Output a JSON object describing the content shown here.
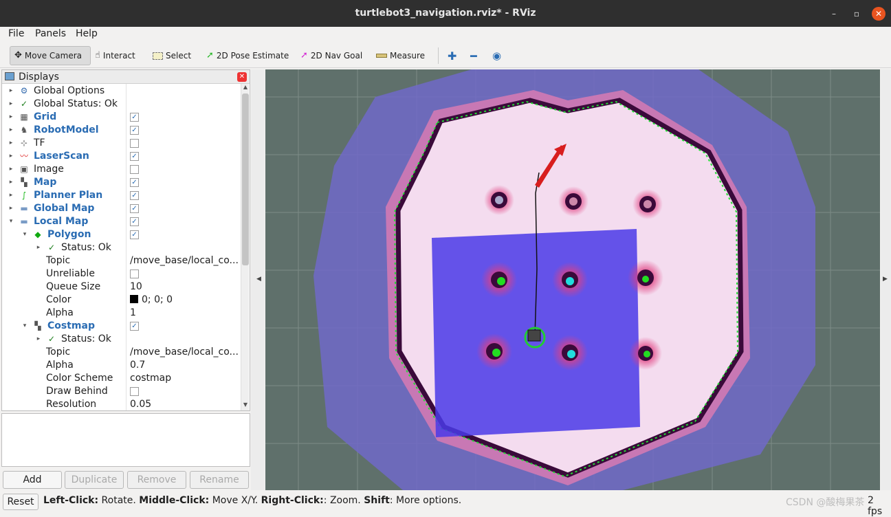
{
  "window": {
    "title": "turtlebot3_navigation.rviz* - RViz",
    "controls": [
      "–",
      "▫",
      "✕"
    ]
  },
  "menu": [
    "File",
    "Panels",
    "Help"
  ],
  "toolbar": {
    "tools": [
      "Move Camera",
      "Interact",
      "Select",
      "2D Pose Estimate",
      "2D Nav Goal",
      "Measure"
    ],
    "active": "Move Camera"
  },
  "displays": {
    "header": "Displays",
    "rows": [
      {
        "label": "Global Options",
        "icon": "gear-icon"
      },
      {
        "label": "Global Status: Ok",
        "icon": "check-icon"
      },
      {
        "label": "Grid",
        "icon": "grid-icon",
        "checked": true
      },
      {
        "label": "RobotModel",
        "icon": "robot-icon",
        "checked": true
      },
      {
        "label": "TF",
        "icon": "axes-icon",
        "checked": false
      },
      {
        "label": "LaserScan",
        "icon": "scan-icon",
        "checked": true
      },
      {
        "label": "Image",
        "icon": "image-icon",
        "checked": false
      },
      {
        "label": "Map",
        "icon": "map-icon",
        "checked": true
      },
      {
        "label": "Planner Plan",
        "icon": "path-icon",
        "checked": true
      },
      {
        "label": "Global Map",
        "icon": "folder-icon",
        "checked": true
      },
      {
        "label": "Local Map",
        "icon": "folder-icon",
        "checked": true
      },
      {
        "label": "Polygon",
        "icon": "polygon-icon",
        "checked": true
      },
      {
        "label": "Status: Ok",
        "icon": "check-icon"
      },
      {
        "label": "Topic",
        "value": "/move_base/local_co..."
      },
      {
        "label": "Unreliable",
        "checked": false
      },
      {
        "label": "Queue Size",
        "value": "10"
      },
      {
        "label": "Color",
        "value": "0; 0; 0"
      },
      {
        "label": "Alpha",
        "value": "1"
      },
      {
        "label": "Costmap",
        "icon": "map-icon",
        "checked": true
      },
      {
        "label": "Status: Ok",
        "icon": "check-icon"
      },
      {
        "label": "Topic",
        "value": "/move_base/local_co..."
      },
      {
        "label": "Alpha",
        "value": "0.7"
      },
      {
        "label": "Color Scheme",
        "value": "costmap"
      },
      {
        "label": "Draw Behind",
        "checked": false
      },
      {
        "label": "Resolution",
        "value": "0.05"
      }
    ]
  },
  "panel_buttons": {
    "add": "Add",
    "duplicate": "Duplicate",
    "remove": "Remove",
    "rename": "Rename"
  },
  "status": {
    "reset": "Reset",
    "hint_parts": [
      {
        "b": "Left-Click:",
        "t": " Rotate. "
      },
      {
        "b": "Middle-Click:",
        "t": " Move X/Y. "
      },
      {
        "b": "Right-Click:",
        "t": ": Zoom. "
      },
      {
        "b": "Shift",
        "t": ": More options."
      }
    ],
    "watermark": "CSDN @酸梅果茶",
    "fps": "2 fps"
  },
  "colors": {
    "selected_blue": "#2a6cb3",
    "close_orange": "#e95420",
    "viewport_bg": "#5f706b"
  }
}
